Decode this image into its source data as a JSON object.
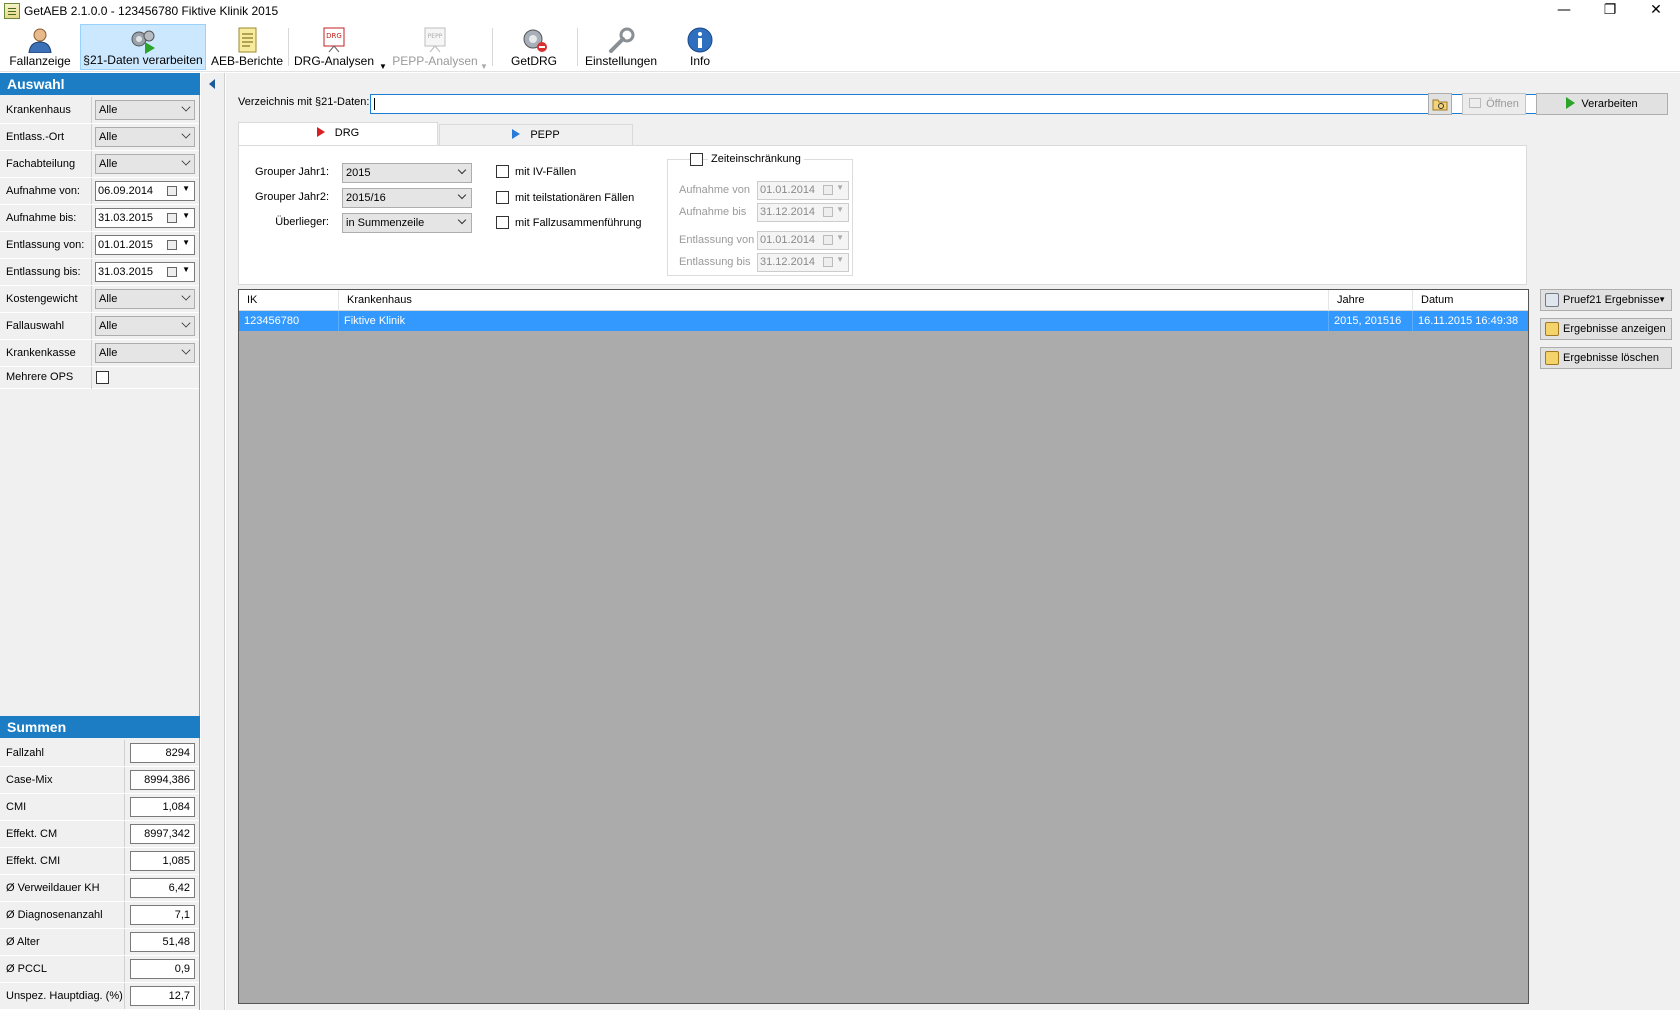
{
  "window": {
    "title": "GetAEB 2.1.0.0 - 123456780 Fiktive Klinik 2015",
    "minimize": "—",
    "maximize": "❐",
    "close": "✕"
  },
  "toolbar": {
    "fallanzeige": "Fallanzeige",
    "daten": "§21-Daten verarbeiten",
    "aeb": "AEB-Berichte",
    "drg": "DRG-Analysen",
    "pepp": "PEPP-Analysen",
    "getdrg": "GetDRG",
    "einstellungen": "Einstellungen",
    "info": "Info"
  },
  "auswahl": {
    "header": "Auswahl",
    "rows": [
      {
        "label": "Krankenhaus",
        "value": "Alle"
      },
      {
        "label": "Entlass.-Ort",
        "value": "Alle"
      },
      {
        "label": "Fachabteilung",
        "value": "Alle"
      },
      {
        "label": "Aufnahme von:",
        "value": "06.09.2014"
      },
      {
        "label": "Aufnahme bis:",
        "value": "31.03.2015"
      },
      {
        "label": "Entlassung von:",
        "value": "01.01.2015"
      },
      {
        "label": "Entlassung bis:",
        "value": "31.03.2015"
      },
      {
        "label": "Kostengewicht",
        "value": "Alle"
      },
      {
        "label": "Fallauswahl",
        "value": "Alle"
      },
      {
        "label": "Krankenkasse",
        "value": "Alle"
      },
      {
        "label": "Mehrere OPS",
        "value": ""
      }
    ]
  },
  "summen": {
    "header": "Summen",
    "rows": [
      {
        "label": "Fallzahl",
        "value": "8294"
      },
      {
        "label": "Case-Mix",
        "value": "8994,386"
      },
      {
        "label": "CMI",
        "value": "1,084"
      },
      {
        "label": "Effekt. CM",
        "value": "8997,342"
      },
      {
        "label": "Effekt. CMI",
        "value": "1,085"
      },
      {
        "label": "Ø Verweildauer KH",
        "value": "6,42"
      },
      {
        "label": "Ø Diagnosenanzahl",
        "value": "7,1"
      },
      {
        "label": "Ø Alter",
        "value": "51,48"
      },
      {
        "label": "Ø PCCL",
        "value": "0,9"
      },
      {
        "label": "Unspez. Hauptdiag. (%)",
        "value": "12,7"
      }
    ]
  },
  "main": {
    "path_label": "Verzeichnis mit §21-Daten:",
    "path_value": "",
    "open_button": "Öffnen",
    "process_button": "Verarbeiten",
    "tabs": {
      "drg": "DRG",
      "pepp": "PEPP"
    },
    "options": {
      "grouper1_label": "Grouper Jahr1:",
      "grouper1_value": "2015",
      "grouper2_label": "Grouper Jahr2:",
      "grouper2_value": "2015/16",
      "ueberlieger_label": "Überlieger:",
      "ueberlieger_value": "in Summenzeile",
      "cb_iv": "mit IV-Fällen",
      "cb_teil": "mit teilstationären Fällen",
      "cb_fall": "mit Fallzusammenführung"
    },
    "zeit": {
      "title": "Zeiteinschränkung",
      "aufnahme_von_label": "Aufnahme von",
      "aufnahme_von": "01.01.2014",
      "aufnahme_bis_label": "Aufnahme bis",
      "aufnahme_bis": "31.12.2014",
      "entlassung_von_label": "Entlassung von",
      "entlassung_von": "01.01.2014",
      "entlassung_bis_label": "Entlassung bis",
      "entlassung_bis": "31.12.2014"
    },
    "grid": {
      "headers": {
        "ik": "IK",
        "kh": "Krankenhaus",
        "jahre": "Jahre",
        "datum": "Datum"
      },
      "rows": [
        {
          "ik": "123456780",
          "kh": "Fiktive Klinik",
          "jahre": "2015, 201516",
          "datum": "16.11.2015 16:49:38"
        }
      ]
    },
    "side_buttons": {
      "pruef": "Pruef21 Ergebnisse",
      "anzeigen": "Ergebnisse anzeigen",
      "loeschen": "Ergebnisse löschen"
    }
  }
}
